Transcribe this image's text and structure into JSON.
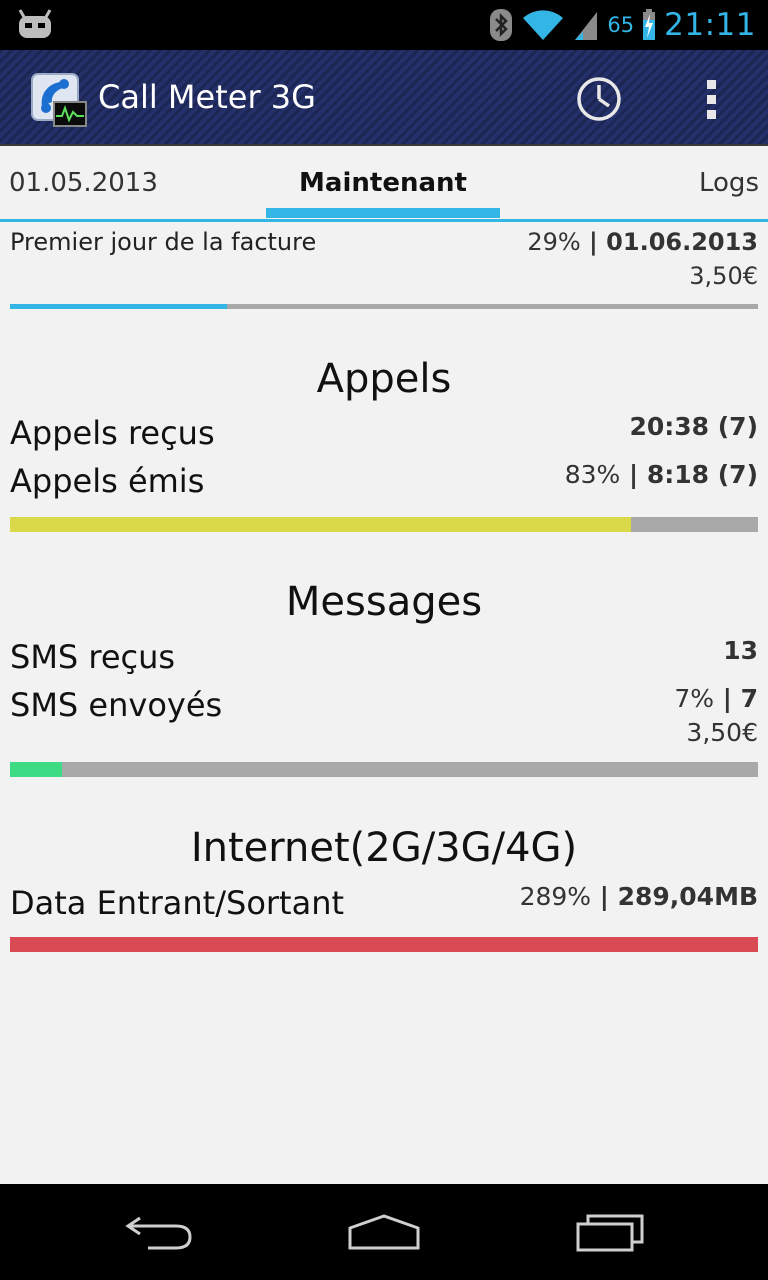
{
  "status_bar": {
    "battery_percent": "65",
    "time": "21:11",
    "icons": [
      "cyanogenmod-icon",
      "bluetooth-icon",
      "wifi-icon",
      "signal-icon",
      "battery-charging-icon"
    ]
  },
  "action_bar": {
    "title": "Call Meter 3G",
    "icons": [
      "app-icon",
      "history-icon",
      "overflow-menu-icon"
    ]
  },
  "tabs": {
    "prev": "01.05.2013",
    "current": "Maintenant",
    "next": "Logs"
  },
  "billing": {
    "label": "Premier jour de la facture",
    "percent": "29%",
    "separator": " | ",
    "date": "01.06.2013",
    "cost": "3,50€",
    "progress": 0.29,
    "color": "#33b5e5"
  },
  "calls": {
    "title": "Appels",
    "in_label": "Appels reçus",
    "in_value": "20:38 (7)",
    "out_label": "Appels émis",
    "out_percent": "83%",
    "separator": " | ",
    "out_value": "8:18 (7)",
    "progress": 0.83,
    "color": "#d9d94a"
  },
  "messages": {
    "title": "Messages",
    "in_label": "SMS reçus",
    "in_value": "13",
    "out_label": "SMS envoyés",
    "out_percent": "7%",
    "separator": " | ",
    "out_value": "7",
    "cost": "3,50€",
    "progress": 0.07,
    "color": "#3ddc84"
  },
  "internet": {
    "title": "Internet(2G/3G/4G)",
    "label": "Data Entrant/Sortant",
    "percent": "289%",
    "separator": " | ",
    "value": "289,04MB",
    "progress": 1.0,
    "color": "#d94a54"
  },
  "nav_bar": {
    "icons": [
      "back-icon",
      "home-icon",
      "recent-apps-icon"
    ]
  }
}
